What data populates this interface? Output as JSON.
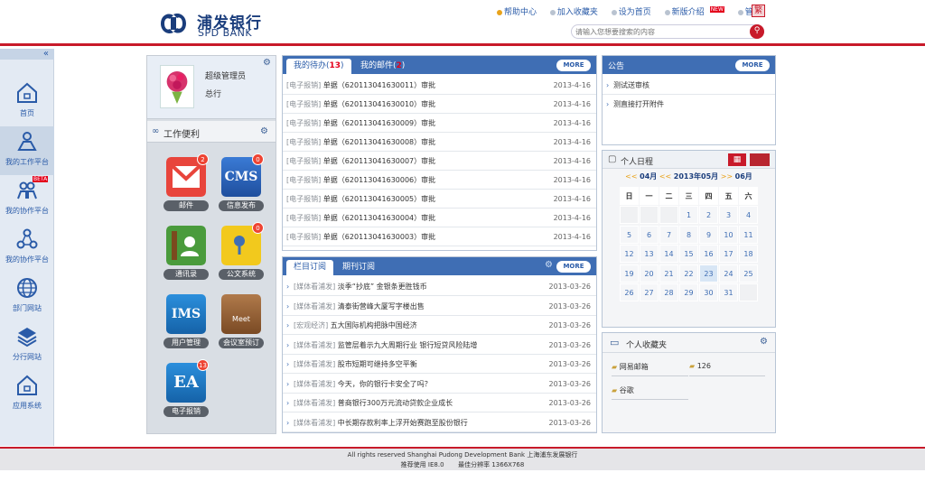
{
  "brand": {
    "name_cn": "浦发银行",
    "name_en": "SPD BANK"
  },
  "toplinks": [
    {
      "label": "帮助中心"
    },
    {
      "label": "加入收藏夹"
    },
    {
      "label": "设为首页"
    },
    {
      "label": "新版介绍",
      "badge": "NEW"
    },
    {
      "label": "管理"
    }
  ],
  "lang_btn": "繁",
  "search": {
    "placeholder": "请输入您想要搜索的内容"
  },
  "sidebar": {
    "collapse": "«",
    "items": [
      {
        "label": "首页",
        "icon": "home-icon"
      },
      {
        "label": "我的工作平台",
        "icon": "person-work-icon"
      },
      {
        "label": "我的协作平台",
        "icon": "people-icon",
        "badge": "BETA"
      },
      {
        "label": "我的协作平台",
        "icon": "share-icon"
      },
      {
        "label": "部门网站",
        "icon": "globe-icon"
      },
      {
        "label": "分行网站",
        "icon": "layers-icon"
      },
      {
        "label": "应用系统",
        "icon": "home-icon"
      }
    ]
  },
  "profile": {
    "role": "超级管理员",
    "title": "总行"
  },
  "tools": {
    "header": "工作便利",
    "apps": [
      {
        "label": "邮件",
        "badge": "2",
        "icon": "mail-icon"
      },
      {
        "label": "信息发布",
        "badge": "0",
        "icon": "cms-icon",
        "glyph": "CMS"
      },
      {
        "label": "通讯录",
        "badge": "",
        "icon": "contacts-icon"
      },
      {
        "label": "公文系统",
        "badge": "0",
        "icon": "documents-icon"
      },
      {
        "label": "用户管理",
        "badge": "",
        "icon": "ims-icon",
        "glyph": "IMS"
      },
      {
        "label": "会议室预订",
        "badge": "",
        "icon": "meeting-icon",
        "glyph": "Meet"
      },
      {
        "label": "电子报销",
        "badge": "13",
        "icon": "ea-icon",
        "glyph": "EA"
      }
    ]
  },
  "todo": {
    "tabs": [
      {
        "label": "我的待办(",
        "count": "13",
        "suffix": ")"
      },
      {
        "label": "我的邮件(",
        "count": "2",
        "suffix": ")"
      }
    ],
    "more": "MORE",
    "rows": [
      {
        "tag": "[电子报销]",
        "text": "单据（620113041630011）审批",
        "date": "2013-4-16"
      },
      {
        "tag": "[电子报销]",
        "text": "单据（620113041630010）审批",
        "date": "2013-4-16"
      },
      {
        "tag": "[电子报销]",
        "text": "单据（620113041630009）审批",
        "date": "2013-4-16"
      },
      {
        "tag": "[电子报销]",
        "text": "单据（620113041630008）审批",
        "date": "2013-4-16"
      },
      {
        "tag": "[电子报销]",
        "text": "单据（620113041630007）审批",
        "date": "2013-4-16"
      },
      {
        "tag": "[电子报销]",
        "text": "单据（620113041630006）审批",
        "date": "2013-4-16"
      },
      {
        "tag": "[电子报销]",
        "text": "单据（620113041630005）审批",
        "date": "2013-4-16"
      },
      {
        "tag": "[电子报销]",
        "text": "单据（620113041630004）审批",
        "date": "2013-4-16"
      },
      {
        "tag": "[电子报销]",
        "text": "单据（620113041630003）审批",
        "date": "2013-4-16"
      }
    ]
  },
  "subs": {
    "tabs": [
      {
        "label": "栏目订阅"
      },
      {
        "label": "期刊订阅"
      }
    ],
    "more": "MORE",
    "rows": [
      {
        "tag": "[媒体看浦发]",
        "text": "淡季“抄底” 金银条更胜钱币",
        "date": "2013-03-26"
      },
      {
        "tag": "[媒体看浦发]",
        "text": "清泰街营峰大厦写字楼出售",
        "date": "2013-03-26"
      },
      {
        "tag": "[宏观经济]",
        "text": "五大国际机构把脉中国经济",
        "date": "2013-03-26"
      },
      {
        "tag": "[媒体看浦发]",
        "text": "监管层着示九大周期行业 银行短贷风险陆增",
        "date": "2013-03-26"
      },
      {
        "tag": "[媒体看浦发]",
        "text": "股市短期可继持多空平衡",
        "date": "2013-03-26"
      },
      {
        "tag": "[媒体看浦发]",
        "text": "今天，你的银行卡安全了吗？",
        "date": "2013-03-26"
      },
      {
        "tag": "[媒体看浦发]",
        "text": "普商银行300万元流动贷款企业成长",
        "date": "2013-03-26"
      },
      {
        "tag": "[媒体看浦发]",
        "text": "中长期存款利率上浮开始赛跑至股份银行",
        "date": "2013-03-26"
      }
    ]
  },
  "notice": {
    "title": "公告",
    "more": "MORE",
    "items": [
      "测试送审核",
      "测直接打开附件"
    ]
  },
  "calendar": {
    "title": "个人日程",
    "prev_month": "04月",
    "current": "2013年05月",
    "next_month": "06月",
    "prev_arrows": "<<",
    "next_arrows": ">>",
    "weekdays": [
      "日",
      "一",
      "二",
      "三",
      "四",
      "五",
      "六"
    ],
    "days": [
      "",
      "",
      "",
      "1",
      "2",
      "3",
      "4",
      "5",
      "6",
      "7",
      "8",
      "9",
      "10",
      "11",
      "12",
      "13",
      "14",
      "15",
      "16",
      "17",
      "18",
      "19",
      "20",
      "21",
      "22",
      "23",
      "24",
      "25",
      "26",
      "27",
      "28",
      "29",
      "30",
      "31",
      ""
    ],
    "today": "23"
  },
  "favorites": {
    "title": "个人收藏夹",
    "items": [
      "网易邮箱",
      "126",
      "谷歌"
    ]
  },
  "footer": {
    "line1": "All rights reserved Shanghai Pudong Development Bank 上海浦东发展银行",
    "line2a": "推荐使用 IE8.0",
    "line2b": "最佳分辨率 1366X768"
  }
}
